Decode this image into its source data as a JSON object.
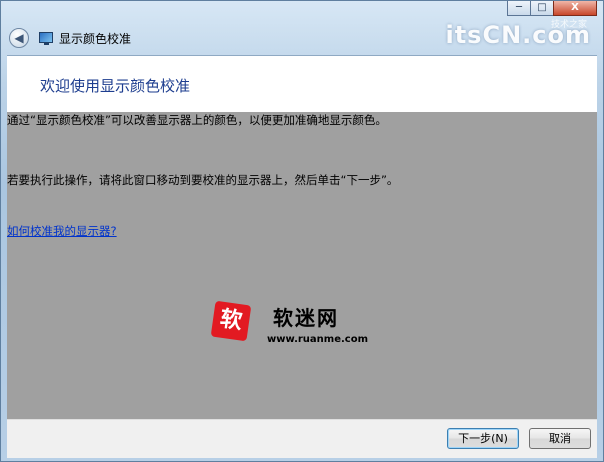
{
  "window": {
    "title": "显示颜色校准",
    "controls": {
      "minimize": "─",
      "maximize": "□",
      "close": "X"
    },
    "brand": "itsCN.com",
    "brand_sub": "技术之家"
  },
  "header": {
    "title": "欢迎使用显示颜色校准"
  },
  "content": {
    "para1": "通过“显示颜色校准”可以改善显示器上的颜色，以便更加准确地显示颜色。",
    "para2": "若要执行此操作，请将此窗口移动到要校准的显示器上，然后单击“下一步”。",
    "link": "如何校准我的显示器?"
  },
  "watermark": {
    "mark": "软",
    "name": "软迷网",
    "url": "www.ruanme.com"
  },
  "buttons": {
    "next": "下一步(N)",
    "cancel": "取消"
  },
  "colors": {
    "content_bg": "#a0a0a0",
    "header_title": "#1d3d8f",
    "link": "#0033cc"
  }
}
